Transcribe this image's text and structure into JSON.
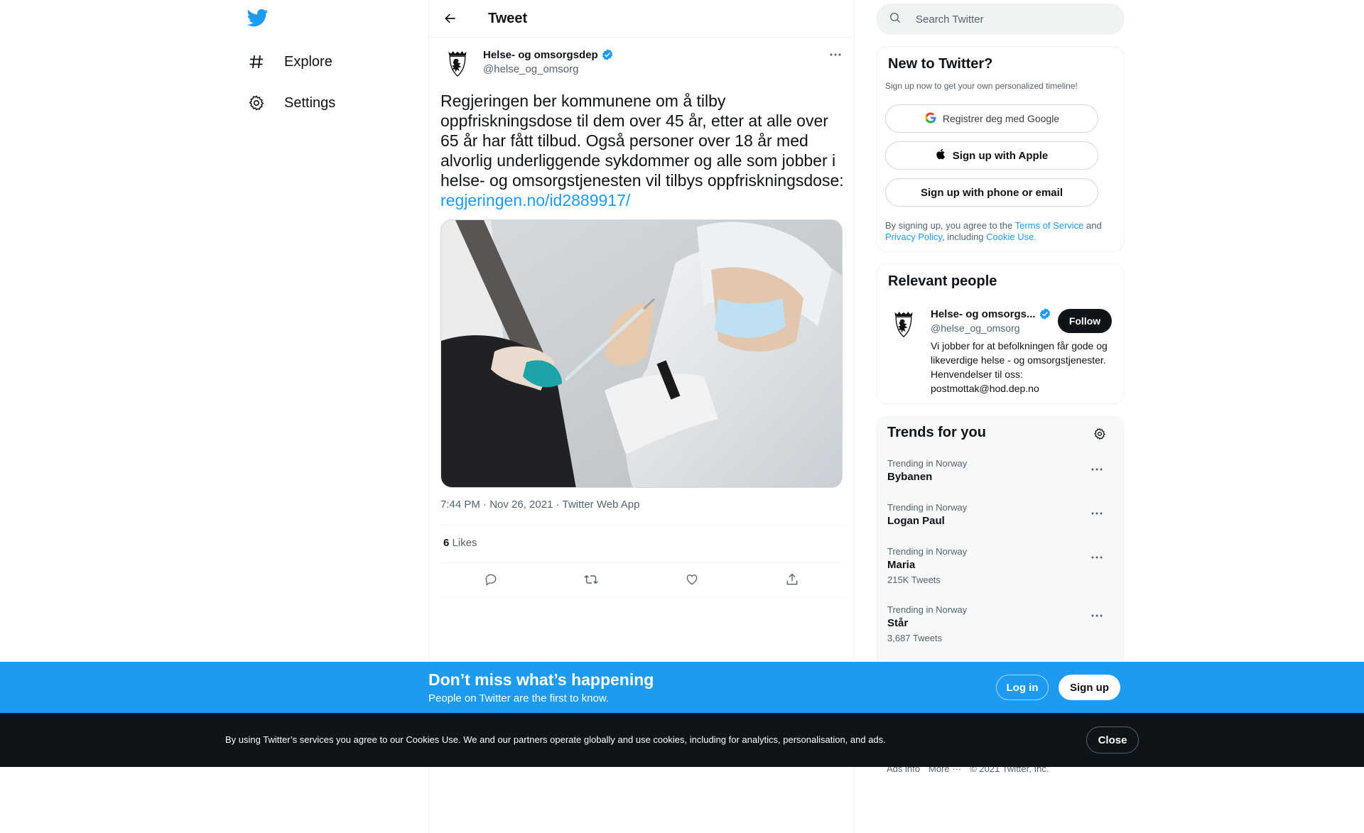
{
  "nav": {
    "logo_icon": "twitter-bird-icon",
    "items": [
      {
        "label": "Explore",
        "icon": "hashtag-icon"
      },
      {
        "label": "Settings",
        "icon": "gear-icon"
      }
    ]
  },
  "tweet_header": {
    "title": "Tweet"
  },
  "tweet": {
    "author_name": "Helse- og omsorgsdep",
    "author_handle": "@helse_og_omsorg",
    "text": "Regjeringen ber kommunene om å tilby oppfriskningsdose til dem over 45 år, etter at alle over 65 år har fått tilbud. Også personer over 18 år med alvorlig underliggende sykdommer og alle som jobber i helse- og omsorgstjenesten vil tilbys oppfriskningsdose:",
    "link": "regjeringen.no/id2889917/",
    "meta": "7:44 PM · Nov 26, 2021 · Twitter Web App",
    "likes_count": "6",
    "likes_label": "Likes"
  },
  "search": {
    "placeholder": "Search Twitter"
  },
  "signup_card": {
    "title": "New to Twitter?",
    "subtitle": "Sign up now to get your own personalized timeline!",
    "google_label": "Registrer deg med Google",
    "apple_label": "Sign up with Apple",
    "phone_label": "Sign up with phone or email",
    "legal_prefix": "By signing up, you agree to the ",
    "terms_label": "Terms of Service",
    "legal_and": " and ",
    "privacy_label": "Privacy Policy",
    "legal_including": ", including ",
    "cookie_label": "Cookie Use."
  },
  "relevant_people": {
    "title": "Relevant people",
    "name": "Helse- og omsorgs...",
    "handle": "@helse_og_omsorg",
    "follow_label": "Follow",
    "bio": "Vi jobber for at befolkningen får gode og likeverdige helse - og omsorgstjenester. Henvendelser til oss: postmottak@hod.dep.no"
  },
  "trends": {
    "title": "Trends for you",
    "items": [
      {
        "context": "Trending in Norway",
        "name": "Bybanen",
        "count": ""
      },
      {
        "context": "Trending in Norway",
        "name": "Logan Paul",
        "count": ""
      },
      {
        "context": "Trending in Norway",
        "name": "Maria",
        "count": "215K Tweets"
      },
      {
        "context": "Trending in Norway",
        "name": "Står",
        "count": "3,687 Tweets"
      }
    ]
  },
  "footer": {
    "links": [
      "Ads info",
      "More ···",
      "© 2021 Twitter, Inc."
    ]
  },
  "banner": {
    "title": "Don’t miss what’s happening",
    "subtitle": "People on Twitter are the first to know.",
    "login_label": "Log in",
    "signup_label": "Sign up"
  },
  "cookie_bar": {
    "text": "By using Twitter’s services you agree to our Cookies Use. We and our partners operate globally and use cookies, including for analytics, personalisation, and ads.",
    "close_label": "Close"
  },
  "colors": {
    "brand": "#1d9bf0",
    "text": "#0f1419",
    "secondary": "#536471",
    "cookie_bg": "#0f1419"
  }
}
